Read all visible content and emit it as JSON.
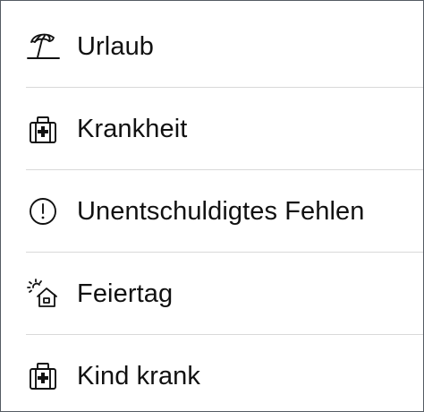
{
  "menu": {
    "items": [
      {
        "label": "Urlaub",
        "icon": "beach-umbrella-icon"
      },
      {
        "label": "Krankheit",
        "icon": "first-aid-kit-icon"
      },
      {
        "label": "Unentschuldigtes Fehlen",
        "icon": "exclamation-circle-icon"
      },
      {
        "label": "Feiertag",
        "icon": "sun-house-icon"
      },
      {
        "label": "Kind krank",
        "icon": "first-aid-kit-icon"
      }
    ]
  },
  "colors": {
    "text": "#111111",
    "divider": "#d9d9d9",
    "border": "#555b63",
    "background": "#ffffff"
  }
}
